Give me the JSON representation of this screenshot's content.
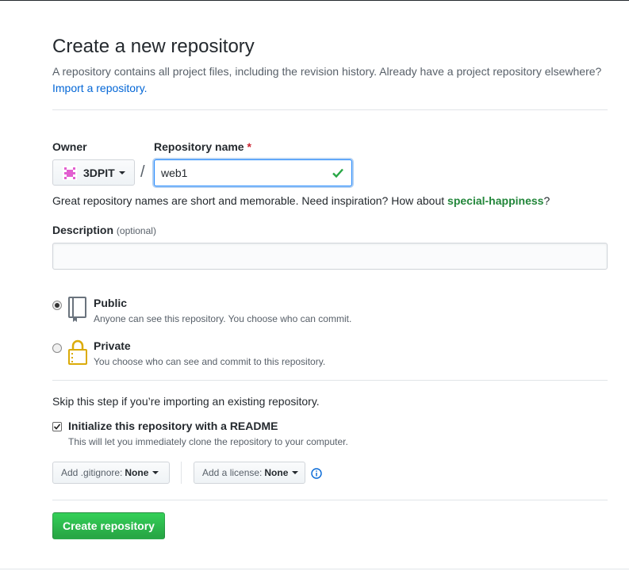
{
  "header": {
    "title": "Create a new repository",
    "subtitle": "A repository contains all project files, including the revision history. Already have a project repository elsewhere?",
    "import_link": "Import a repository."
  },
  "owner": {
    "label": "Owner",
    "value": "3DPIT"
  },
  "repo_name": {
    "label": "Repository name",
    "required_mark": "*",
    "value": "web1"
  },
  "hint": {
    "text": "Great repository names are short and memorable. Need inspiration? How about ",
    "suggestion": "special-happiness",
    "end": "?"
  },
  "description": {
    "label": "Description",
    "optional": "(optional)",
    "value": ""
  },
  "visibility": {
    "selected": "public",
    "public": {
      "title": "Public",
      "note": "Anyone can see this repository. You choose who can commit."
    },
    "private": {
      "title": "Private",
      "note": "You choose who can see and commit to this repository."
    }
  },
  "init": {
    "skip_text": "Skip this step if you’re importing an existing repository.",
    "readme_label": "Initialize this repository with a README",
    "readme_checked": true,
    "readme_note": "This will let you immediately clone the repository to your computer."
  },
  "gitignore": {
    "prefix": "Add .gitignore:",
    "value": "None"
  },
  "license": {
    "prefix": "Add a license:",
    "value": "None"
  },
  "submit": {
    "label": "Create repository"
  },
  "colors": {
    "accent_blue": "#0366d6",
    "success_green": "#28a745",
    "avatar_pink": "#e25fd0"
  }
}
